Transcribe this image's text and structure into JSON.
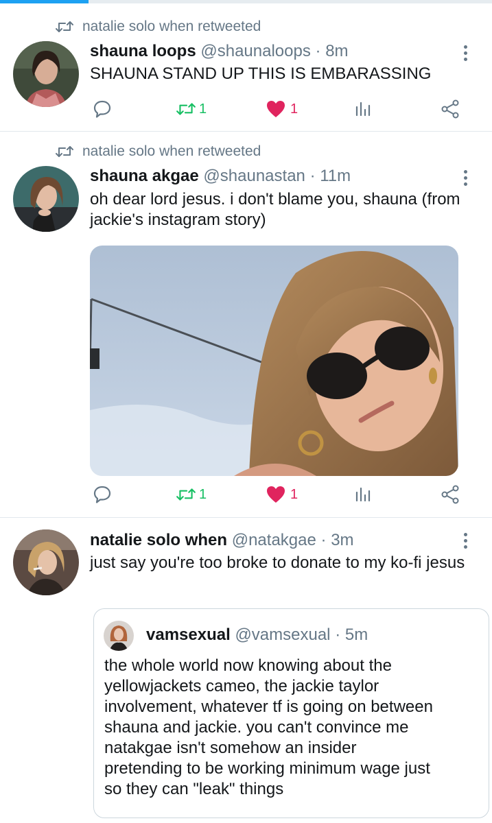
{
  "progress": {
    "fraction": 0.18,
    "color": "#1da1f2"
  },
  "tweets": [
    {
      "retweeted_by": "natalie solo when retweeted",
      "name": "shauna loops",
      "handle": "@shaunaloops",
      "dot": "·",
      "time": "8m",
      "text": "SHAUNA STAND UP THIS IS EMBARASSING",
      "retweets": "1",
      "likes": "1"
    },
    {
      "retweeted_by": "natalie solo when retweeted",
      "name": "shauna akgae",
      "handle": "@shaunastan",
      "dot": "·",
      "time": "11m",
      "text": "oh dear lord jesus. i don't blame you, shauna (from jackie's instagram story)",
      "retweets": "1",
      "likes": "1"
    },
    {
      "name": "natalie solo when",
      "handle": "@natakgae",
      "dot": "·",
      "time": "3m",
      "text": "just say you're too broke to donate to my ko-fi jesus",
      "quote": {
        "name": "vamsexual",
        "handle": "@vamsexual",
        "dot": "·",
        "time": "5m",
        "text": "the whole world now knowing about the yellowjackets cameo, the jackie taylor involvement, whatever tf is going on between shauna and jackie. you can't convince me natakgae isn't somehow an insider pretending to be working minimum wage just so they can \"leak\" things"
      }
    }
  ],
  "colors": {
    "accent": "#1da1f2",
    "retweet": "#17bf63",
    "like": "#e0245e",
    "muted": "#657786"
  },
  "icons": [
    "retweet-icon",
    "reply-icon",
    "heart-icon",
    "analytics-icon",
    "share-icon",
    "more-icon"
  ]
}
